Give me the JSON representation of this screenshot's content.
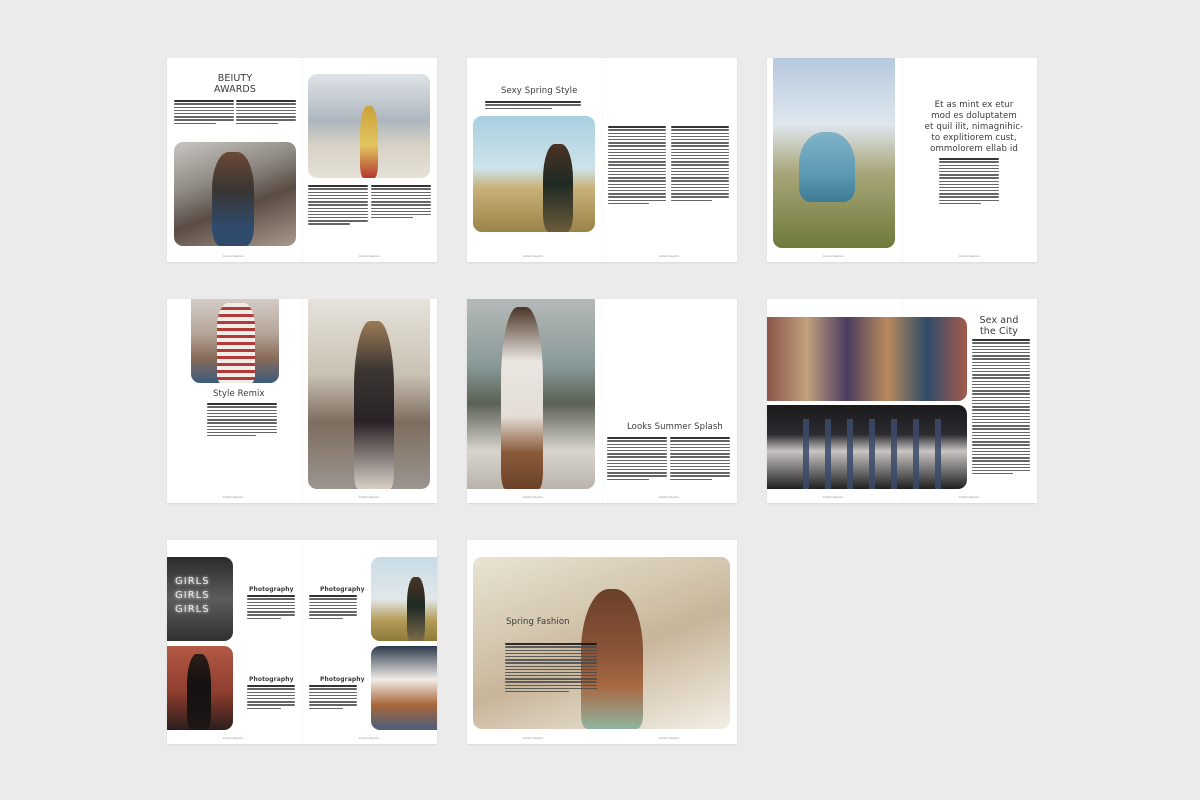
{
  "spreads": [
    {
      "title_lines": [
        "BEIUTY",
        "AWARDS"
      ],
      "folio_left": "Fashion Magazine",
      "folio_right": "Fashion Magazine"
    },
    {
      "title": "Sexy Spring Style",
      "folio_left": "Fashion Magazine",
      "folio_right": "Fashion Magazine"
    },
    {
      "quote_lines": [
        "Et as mint ex etur",
        "mod es doluptatem",
        "et quil ilit, nimagnihic-",
        "to explitiorem cust,",
        "ommolorem ellab id"
      ],
      "folio_left": "Fashion Magazine",
      "folio_right": "Fashion Magazine"
    },
    {
      "title": "Style Remix",
      "folio_left": "Fashion Magazine",
      "folio_right": "Fashion Magazine"
    },
    {
      "title": "Looks Summer Splash",
      "folio_left": "Fashion Magazine",
      "folio_right": "Fashion Magazine"
    },
    {
      "title_lines": [
        "Sex and",
        "the City"
      ],
      "folio_left": "Fashion Magazine",
      "folio_right": "Fashion Magazine"
    },
    {
      "headings": [
        "Photography",
        "Photography",
        "Photography",
        "Photography"
      ],
      "neon_lines": [
        "GIRLS",
        "GIRLS",
        "GIRLS"
      ],
      "folio_left": "Fashion Magazine",
      "folio_right": "Fashion Magazine"
    },
    {
      "title": "Spring Fashion",
      "folio_left": "Fashion Magazine",
      "folio_right": "Fashion Magazine"
    }
  ]
}
